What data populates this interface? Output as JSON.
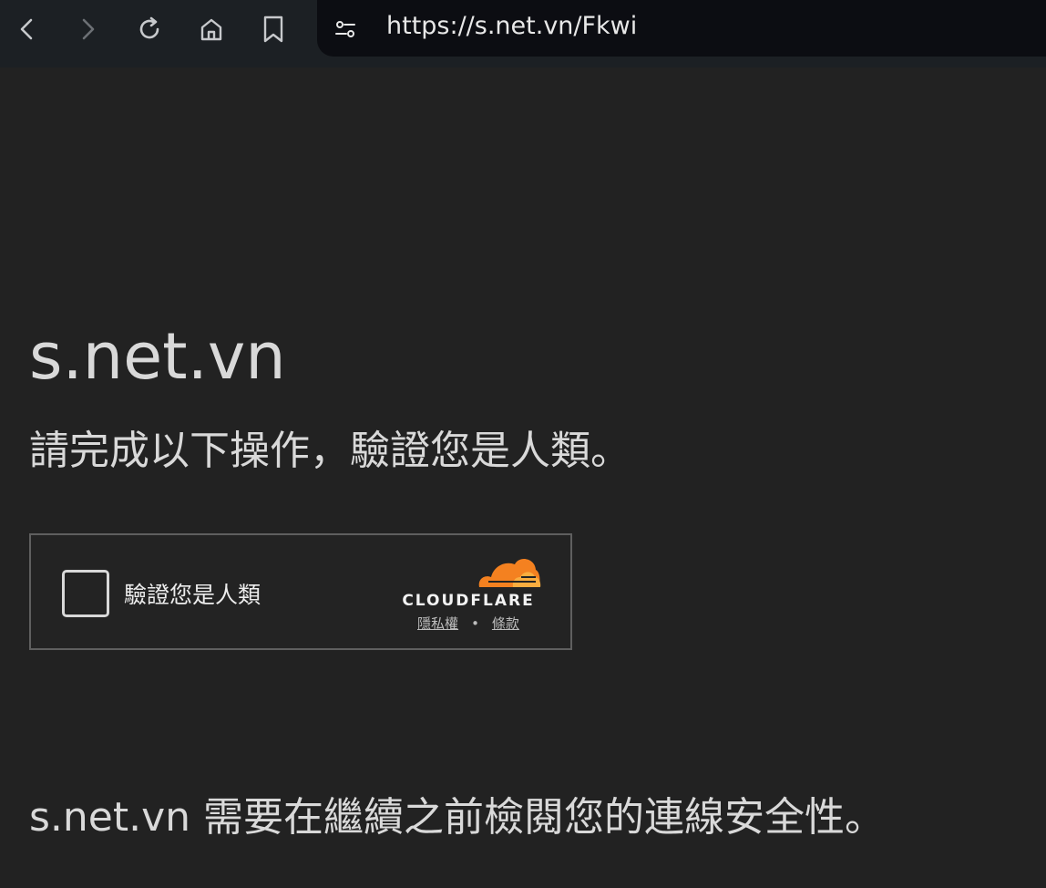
{
  "browser": {
    "url": "https://s.net.vn/Fkwi",
    "icons": [
      "back-icon",
      "forward-icon",
      "reload-icon",
      "home-icon",
      "bookmark-icon",
      "site-info-icon"
    ]
  },
  "page": {
    "site_name": "s.net.vn",
    "instruction": "請完成以下操作，驗證您是人類。",
    "security_note": "s.net.vn 需要在繼續之前檢閱您的連線安全性。"
  },
  "widget": {
    "checkbox_label": "驗證您是人類",
    "brand": "CLOUDFLARE",
    "privacy_link": "隱私權",
    "separator": "•",
    "terms_link": "條款",
    "colors": {
      "cloud_primary": "#f48120",
      "cloud_secondary": "#faad3f"
    }
  }
}
